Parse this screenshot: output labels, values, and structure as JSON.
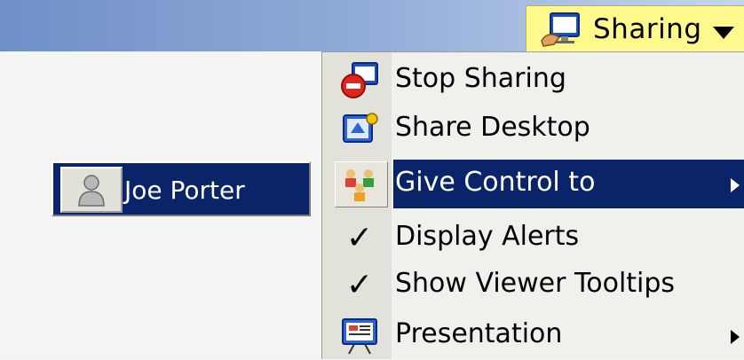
{
  "toolbar": {
    "sharing_label": "Sharing",
    "sharing_icon": "share-monitor-icon",
    "dropdown_icon": "chevron-down-icon"
  },
  "menu": {
    "items": [
      {
        "label": "Stop Sharing",
        "icon": "stop-sharing-icon"
      },
      {
        "label": "Share Desktop",
        "icon": "share-desktop-icon"
      },
      {
        "label": "Give Control to",
        "icon": "give-control-icon",
        "selected": true,
        "submenu": true
      },
      {
        "label": "Display Alerts",
        "icon": "check-icon",
        "checked": true
      },
      {
        "label": "Show Viewer Tooltips",
        "icon": "check-icon",
        "checked": true
      },
      {
        "label": "Presentation",
        "icon": "presentation-icon",
        "submenu": true
      }
    ]
  },
  "user": {
    "name": "Joe Porter",
    "icon": "user-icon"
  },
  "colors": {
    "highlight": "#0a246a",
    "sharing_bg": "#fff88c"
  }
}
